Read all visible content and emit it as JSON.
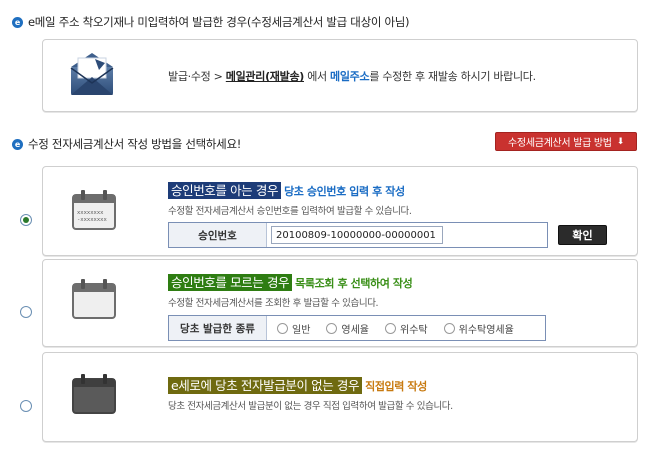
{
  "section1": {
    "title": "e메일 주소 착오기재나 미입력하여 발급한 경우(수정세금계산서 발급 대상이 아님)"
  },
  "notice": {
    "part1": "발급·수정 > ",
    "link": "메일관리(재발송)",
    "part2": " 에서 ",
    "email": "메일주소",
    "part3": "를 수정한 후 재발송 하시기 바랍니다."
  },
  "section2": {
    "title": "수정 전자세금계산서 작성 방법을 선택하세요!",
    "guide_button": "수정세금계산서 발급 방법",
    "guide_icon": "download-icon"
  },
  "option1": {
    "selected": true,
    "highlight": "승인번호를 아는 경우",
    "sub": "당초 승인번호 입력 후 작성",
    "desc": "수정할 전자세금계산서 승인번호를 입력하여 발급할 수 있습니다.",
    "field_label": "승인번호",
    "field_value": "20100809-10000000-00000001",
    "confirm_button": "확인",
    "icon_text": "xxxxxxxx\n-xxxxxxxx"
  },
  "option2": {
    "selected": false,
    "highlight": "승인번호를 모르는 경우",
    "sub": "목록조회 후 선택하여 작성",
    "desc": "수정할 전자세금계산서를 조회한 후 발급할 수 있습니다.",
    "field_label": "당초 발급한 종류",
    "types": [
      "일반",
      "영세율",
      "위수탁",
      "위수탁영세율"
    ]
  },
  "option3": {
    "selected": false,
    "highlight": "e세로에 당초 전자발급분이 없는 경우",
    "sub": "직접입력 작성",
    "desc": "당초 전자세금계산서 발급분이 없는 경우 직접 입력하여 발급할 수 있습니다."
  },
  "colors": {
    "accent_blue": "#1a6cc4",
    "guide_red": "#c9322f",
    "navy": "#1d3c78",
    "green": "#2e7d12",
    "olive": "#6f6a10"
  }
}
